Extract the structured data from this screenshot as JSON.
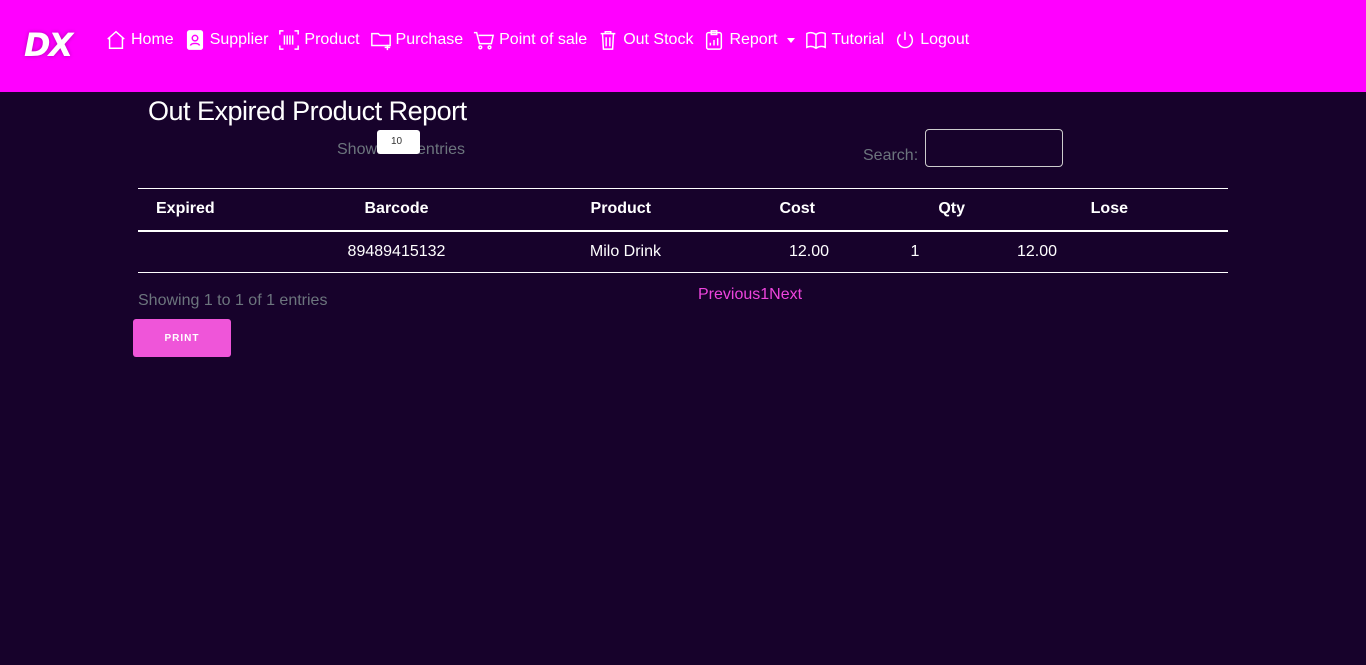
{
  "brand": "DX",
  "nav": [
    {
      "label": "Home",
      "icon": "home-icon"
    },
    {
      "label": "Supplier",
      "icon": "contact-card-icon"
    },
    {
      "label": "Product",
      "icon": "barcode-icon"
    },
    {
      "label": "Purchase",
      "icon": "folder-plus-icon"
    },
    {
      "label": "Point of sale",
      "icon": "cart-icon"
    },
    {
      "label": "Out Stock",
      "icon": "trash-icon"
    },
    {
      "label": "Report",
      "icon": "clipboard-chart-icon"
    },
    {
      "label": "Tutorial",
      "icon": "book-icon"
    },
    {
      "label": "Logout",
      "icon": "power-icon"
    }
  ],
  "page": {
    "title": "Out Expired Product Report"
  },
  "length": {
    "prefix": "Show",
    "value": "10",
    "suffix": "entries"
  },
  "search": {
    "label": "Search:",
    "value": ""
  },
  "table": {
    "columns": [
      "Expired",
      "Barcode",
      "Product",
      "Cost",
      "Qty",
      "Lose"
    ],
    "rows": [
      [
        "",
        "89489415132",
        "Milo Drink",
        "12.00",
        "1",
        "12.00"
      ]
    ]
  },
  "info": "Showing 1 to 1 of 1 entries",
  "pagination": {
    "previous": "Previous",
    "page": "1",
    "next": "Next"
  },
  "print_label": "PRINT",
  "colors": {
    "nav": "#ff00ff",
    "background": "#17022b",
    "accent": "#ef55d9"
  }
}
